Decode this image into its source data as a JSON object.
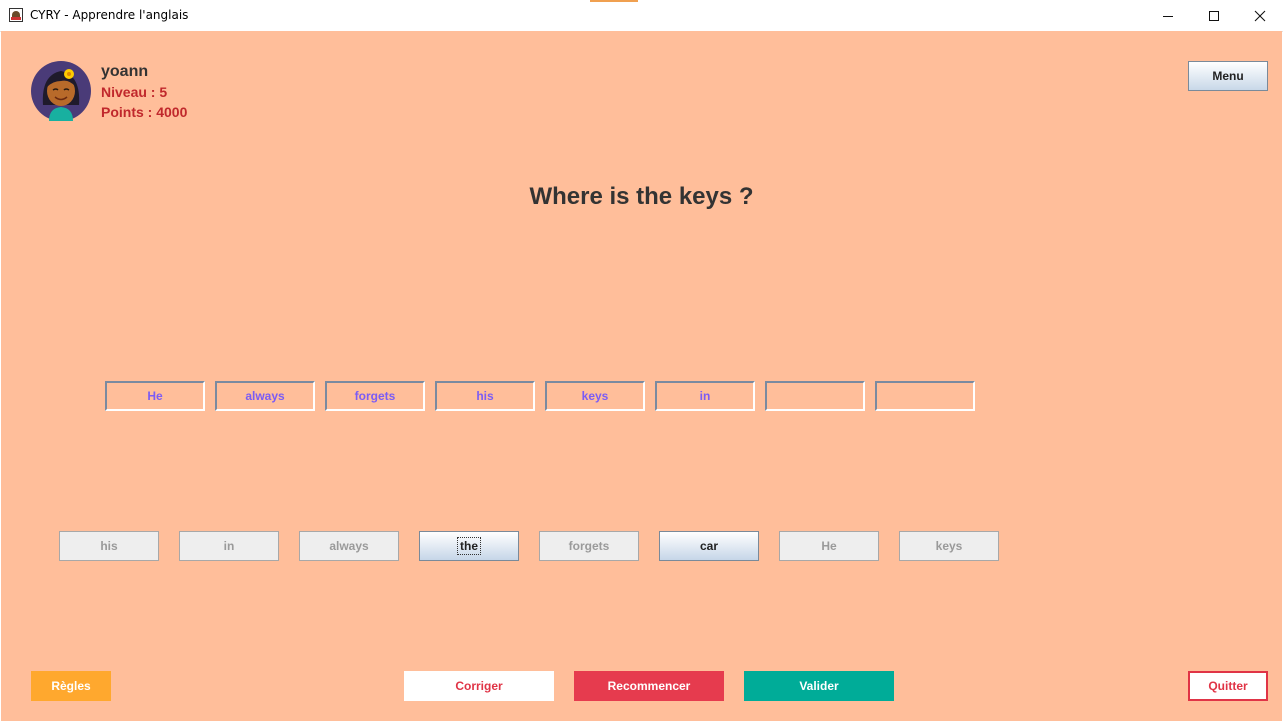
{
  "window": {
    "title": "CYRY - Apprendre l'anglais"
  },
  "user": {
    "name": "yoann",
    "level": "Niveau : 5",
    "points": "Points : 4000"
  },
  "menu_label": "Menu",
  "question": "Where is the keys ?",
  "answer_slots": [
    "He",
    "always",
    "forgets",
    "his",
    "keys",
    "in",
    "",
    ""
  ],
  "word_bank": [
    {
      "label": "his",
      "state": "used"
    },
    {
      "label": "in",
      "state": "used"
    },
    {
      "label": "always",
      "state": "used"
    },
    {
      "label": "the",
      "state": "available"
    },
    {
      "label": "forgets",
      "state": "used"
    },
    {
      "label": "car",
      "state": "available"
    },
    {
      "label": "He",
      "state": "used"
    },
    {
      "label": "keys",
      "state": "used"
    }
  ],
  "footer": {
    "rules": "Règles",
    "correct": "Corriger",
    "restart": "Recommencer",
    "validate": "Valider",
    "quit": "Quitter"
  },
  "colors": {
    "background": "#ffbe9a",
    "slot_text": "#7b5cf5",
    "rules": "#ffa82e",
    "restart": "#e63b4e",
    "validate": "#00ac98",
    "accent_red": "#e03446"
  }
}
